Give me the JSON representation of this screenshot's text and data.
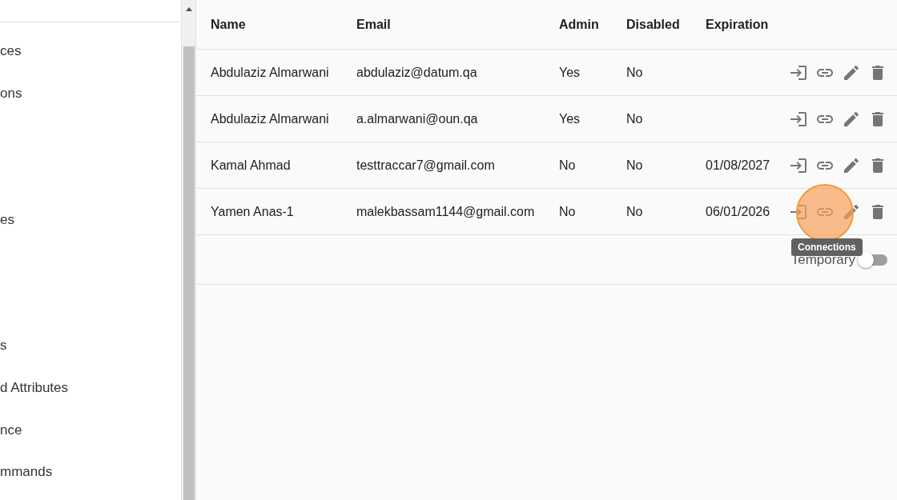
{
  "sidebar": {
    "items": [
      {
        "kind": "item",
        "label": "ces"
      },
      {
        "kind": "item",
        "label": "ons"
      },
      {
        "kind": "spacer"
      },
      {
        "kind": "spacer"
      },
      {
        "kind": "item",
        "label": "es"
      },
      {
        "kind": "spacer"
      },
      {
        "kind": "spacer"
      },
      {
        "kind": "item",
        "label": "s"
      },
      {
        "kind": "item",
        "label": "d Attributes"
      },
      {
        "kind": "item",
        "label": "nce"
      },
      {
        "kind": "item",
        "label": "mmands"
      }
    ]
  },
  "table": {
    "columns": [
      "Name",
      "Email",
      "Admin",
      "Disabled",
      "Expiration"
    ],
    "rows": [
      {
        "cells": [
          "Abdulaziz Almarwani",
          "abdulaziz@datum.qa",
          "Yes",
          "No",
          null
        ]
      },
      {
        "cells": [
          "Abdulaziz Almarwani",
          "a.almarwani@oun.qa",
          "Yes",
          "No",
          null
        ]
      },
      {
        "cells": [
          "Kamal Ahmad",
          "testtraccar7@gmail.com",
          "No",
          "No",
          "01/08/2027"
        ]
      },
      {
        "cells": [
          "Yamen Anas-1",
          "malekbassam1144@gmail.com",
          "No",
          "No",
          "06/01/2026"
        ],
        "tooltip": "Connections"
      }
    ]
  },
  "footer": {
    "toggle": {
      "label": "Temporary",
      "on": false
    }
  }
}
